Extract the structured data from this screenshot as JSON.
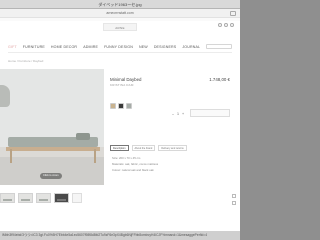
{
  "viewer": {
    "title": "ダイベッド1963ーセ.jpg"
  },
  "browser": {
    "url": "arnecrrnstatt.com"
  },
  "header": {
    "logo": "ARNE"
  },
  "nav": {
    "items": [
      "GIFT",
      "FURNITURE",
      "HOME DECOR",
      "ADMIRE",
      "FUNNY DESIGN",
      "NEW",
      "DESIGNERS",
      "JOURNAL"
    ]
  },
  "breadcrumb": "Home / Furniture / Daybed",
  "product": {
    "name": "Minimal Daybed",
    "price": "1.748,00 €",
    "subtitle": "KRISTINA DAM",
    "qty_minus": "–",
    "qty_value": "1",
    "qty_plus": "+",
    "zoom_label": "Click to zoom",
    "tabs": [
      "Description",
      "About the brand",
      "Delivery and returns"
    ],
    "description": [
      "Size: 200 x 70 x 45 cm",
      "Materials: oak, fabric, cocos mattress",
      "Colour: natural oak and black oak"
    ],
    "swatches": [
      "#c9b38f",
      "#3a3a3a",
      "#a6aca7"
    ]
  },
  "caption": "IMbh3f94ebd/3つつ<IC3 3gt.Fu0%5H7Ebb4e5a1ec5607f98f8d8fd2Tu9zF6e3pX4Bgb6NjFFbb8omtrcyH4ICJF%mnand=1&mesaggePerfid=4"
}
